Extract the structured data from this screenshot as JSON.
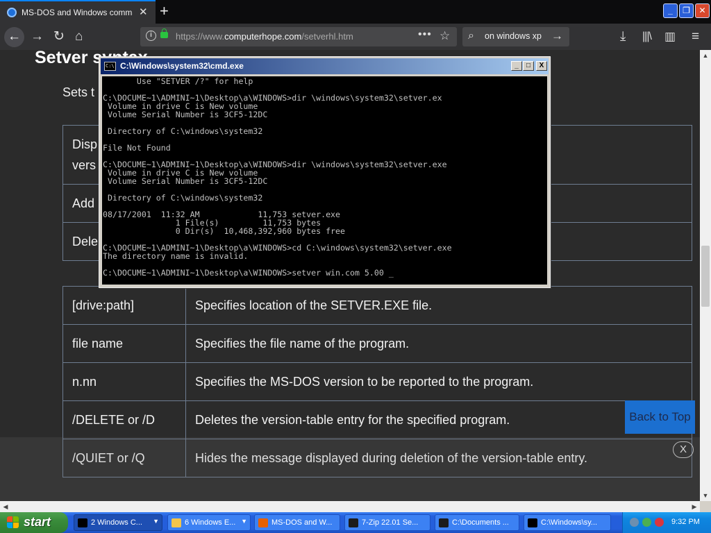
{
  "browser": {
    "tab_title": "MS-DOS and Windows command l",
    "new_tab": "+",
    "url_prefix": "https://www.",
    "url_domain": "computerhope.com",
    "url_path": "/setverhl.htm",
    "search_text": "on windows xp",
    "window_buttons": {
      "minimize": "_",
      "restore": "❐",
      "close": "✕"
    }
  },
  "page": {
    "heading": "Setver syntax",
    "sets_text": "Sets t",
    "top_table": [
      {
        "left": "Disp",
        "left2": "vers"
      },
      {
        "left": "Add"
      },
      {
        "left": "Dele"
      }
    ],
    "params": [
      {
        "name": "[drive:path]",
        "desc": "Specifies location of the SETVER.EXE file."
      },
      {
        "name": "file name",
        "desc": "Specifies the file name of the program."
      },
      {
        "name": "n.nn",
        "desc": "Specifies the MS-DOS version to be reported to the program."
      },
      {
        "name": "/DELETE or /D",
        "desc": "Deletes the version-table entry for the specified program."
      },
      {
        "name": "/QUIET or /Q",
        "desc": "Hides the message displayed during deletion of the version-table entry."
      }
    ],
    "back_to_top": "Back to Top",
    "close_banner": "X"
  },
  "cmd": {
    "title": "C:\\Windows\\system32\\cmd.exe",
    "icon_text": "C:\\",
    "buttons": {
      "minimize": "_",
      "maximize": "□",
      "close": "X"
    },
    "lines": [
      "       Use \"SETVER /?\" for help",
      "",
      "C:\\DOCUME~1\\ADMINI~1\\Desktop\\a\\WINDOWS>dir \\windows\\system32\\setver.ex",
      " Volume in drive C is New volume",
      " Volume Serial Number is 3CF5-12DC",
      "",
      " Directory of C:\\windows\\system32",
      "",
      "File Not Found",
      "",
      "C:\\DOCUME~1\\ADMINI~1\\Desktop\\a\\WINDOWS>dir \\windows\\system32\\setver.exe",
      " Volume in drive C is New volume",
      " Volume Serial Number is 3CF5-12DC",
      "",
      " Directory of C:\\windows\\system32",
      "",
      "08/17/2001  11:32 AM            11,753 setver.exe",
      "               1 File(s)         11,753 bytes",
      "               0 Dir(s)  10,468,392,960 bytes free",
      "",
      "C:\\DOCUME~1\\ADMINI~1\\Desktop\\a\\WINDOWS>cd C:\\windows\\system32\\setver.exe",
      "The directory name is invalid.",
      "",
      "C:\\DOCUME~1\\ADMINI~1\\Desktop\\a\\WINDOWS>setver win.com 5.00 _"
    ]
  },
  "taskbar": {
    "start": "start",
    "tasks": [
      {
        "label": "2 Windows C...",
        "icon": "cmd-icon",
        "has_drop": true
      },
      {
        "label": "6 Windows E...",
        "icon": "folder-icon",
        "has_drop": true
      },
      {
        "label": "MS-DOS and W...",
        "icon": "firefox-icon",
        "has_drop": false
      },
      {
        "label": "7-Zip 22.01 Se...",
        "icon": "7zip-icon",
        "has_drop": false
      },
      {
        "label": "C:\\Documents ...",
        "icon": "7zip-icon",
        "has_drop": false
      },
      {
        "label": "C:\\Windows\\sy...",
        "icon": "cmd-icon",
        "has_drop": false
      }
    ],
    "clock": "9:32 PM"
  }
}
